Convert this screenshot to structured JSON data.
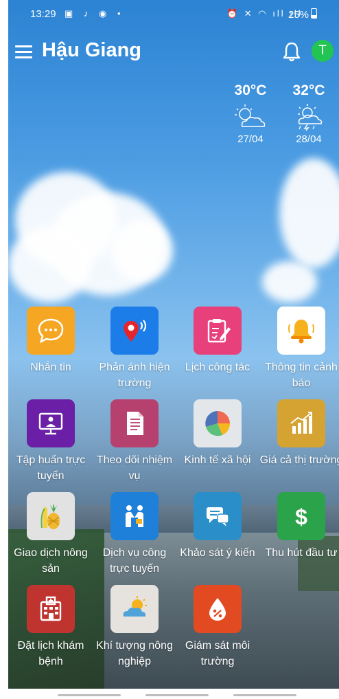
{
  "status_bar": {
    "time": "13:29",
    "battery": "25%"
  },
  "header": {
    "title": "Hậu Giang",
    "avatar_initial": "T"
  },
  "weather": [
    {
      "temp": "30°C",
      "date": "27/04",
      "icon": "partly-sunny-icon"
    },
    {
      "temp": "32°C",
      "date": "28/04",
      "icon": "thunderstorm-sun-icon"
    }
  ],
  "apps": [
    {
      "label": "Nhắn tin",
      "icon": "chat-bubble-icon",
      "color": "#f5a623"
    },
    {
      "label": "Phản ánh hiện trường",
      "icon": "location-pin-icon",
      "color": "#1d7de8"
    },
    {
      "label": "Lịch công tác",
      "icon": "clipboard-edit-icon",
      "color": "#e8407a"
    },
    {
      "label": "Thông tin cảnh báo",
      "icon": "alarm-bell-icon",
      "color": "#ffffff"
    },
    {
      "label": "Tập huấn trực tuyến",
      "icon": "online-training-icon",
      "color": "#6a1fa6"
    },
    {
      "label": "Theo dõi nhiệm vụ",
      "icon": "document-icon",
      "color": "#b7416e"
    },
    {
      "label": "Kinh tế xã hội",
      "icon": "pie-chart-icon",
      "color": "#e4e7ea"
    },
    {
      "label": "Giá cả thị trường",
      "icon": "bar-chart-rising-icon",
      "color": "#d4a332"
    },
    {
      "label": "Giao dịch nông sản",
      "icon": "pineapple-corn-icon",
      "color": "#e2e2e2"
    },
    {
      "label": "Dịch vụ công trực tuyến",
      "icon": "people-service-icon",
      "color": "#1e80d9"
    },
    {
      "label": "Khảo sát ý kiến",
      "icon": "survey-chat-icon",
      "color": "#2a8fc9"
    },
    {
      "label": "Thu hút đầu tư",
      "icon": "dollar-icon",
      "color": "#2aa34a"
    },
    {
      "label": "Đặt lịch khám bệnh",
      "icon": "hospital-icon",
      "color": "#c0342f"
    },
    {
      "label": "Khí tượng nông nghiệp",
      "icon": "sun-cloud-icon",
      "color": "#e6e3df"
    },
    {
      "label": "Giám sát môi trường",
      "icon": "water-drop-percent-icon",
      "color": "#e24a22"
    }
  ]
}
